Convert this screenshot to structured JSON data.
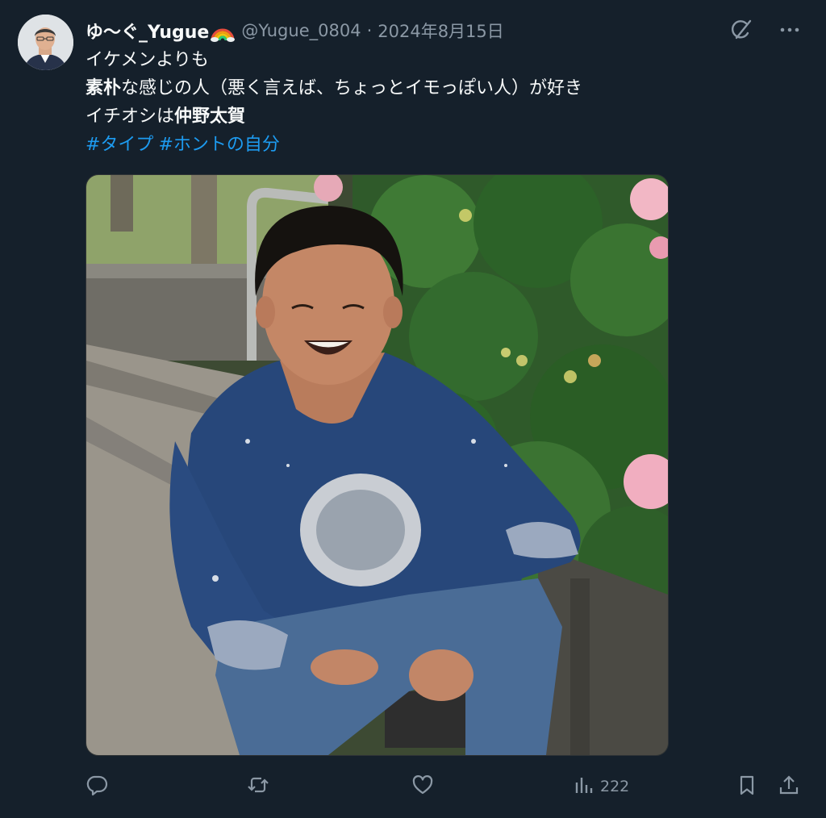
{
  "tweet": {
    "display_name": "ゆ〜ぐ_Yugue",
    "handle": "@Yugue_0804",
    "separator": "·",
    "date": "2024年8月15日",
    "text_lines": [
      [
        {
          "t": "イケメンよりも",
          "b": false
        }
      ],
      [
        {
          "t": "素朴",
          "b": true
        },
        {
          "t": "な感じの人（悪く言えば、ちょっとイモっぽい人）が好き",
          "b": false
        }
      ],
      [
        {
          "t": "イチオシは",
          "b": false
        },
        {
          "t": "仲野太賀",
          "b": true
        }
      ]
    ],
    "hashtags": [
      "#タイプ",
      "#ホントの自分"
    ],
    "views": "222"
  },
  "icons": {
    "grok": "grok-icon",
    "more": "more-icon",
    "reply": "reply-icon",
    "retweet": "retweet-icon",
    "like": "like-icon",
    "views": "views-icon",
    "bookmark": "bookmark-icon",
    "share": "share-icon"
  },
  "colors": {
    "background": "#15202b",
    "text": "#f7f9f9",
    "secondary": "#8b98a5",
    "link": "#1d9bf0"
  }
}
